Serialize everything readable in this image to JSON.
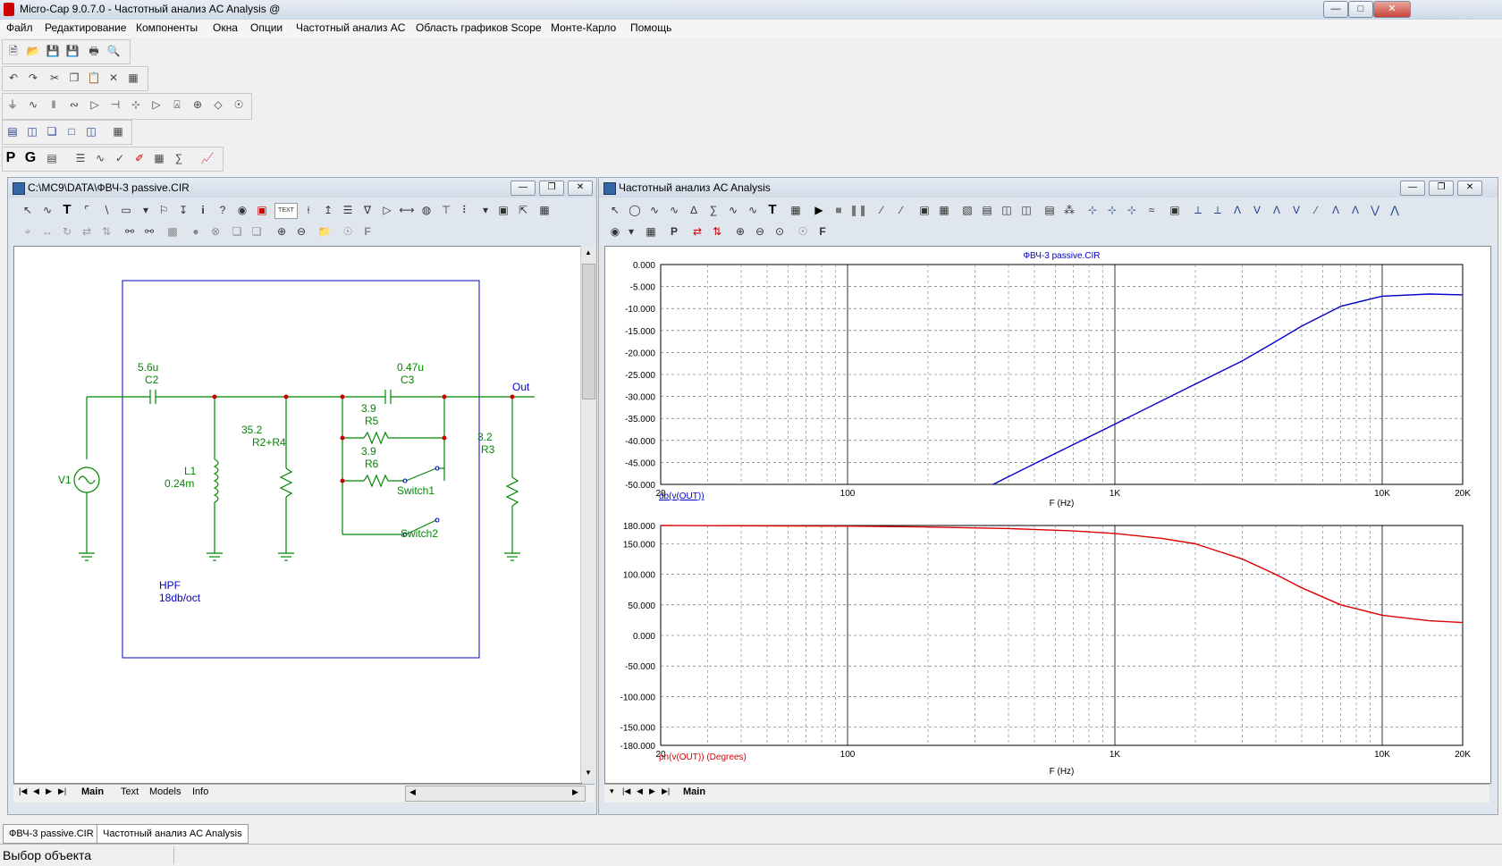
{
  "window": {
    "title": "Micro-Cap 9.0.7.0 - Частотный анализ AC Analysis @"
  },
  "menu": [
    "Файл",
    "Редактирование",
    "Компоненты",
    "Окна",
    "Опции",
    "Частотный анализ AC",
    "Область графиков Scope",
    "Монте-Карло",
    "Помощь"
  ],
  "schematic": {
    "title": "C:\\MC9\\DATA\\ФВЧ-3 passive.CIR",
    "labels": {
      "c2_value": "5.6u",
      "c2_name": "C2",
      "c3_value": "0.47u",
      "c3_name": "C3",
      "out": "Out",
      "l1_name": "L1",
      "l1_value": "0.24m",
      "r24_value": "35.2",
      "r24_name": "R2+R4",
      "r5_value": "3.9",
      "r5_name": "R5",
      "r6_value": "3.9",
      "r6_name": "R6",
      "switch1": "Switch1",
      "switch2": "Switch2",
      "r3_value": "3.2",
      "r3_name": "R3",
      "v1": "V1",
      "hpf": "HPF",
      "slope": "18db/oct"
    },
    "toolbar_text_button": "TEXT",
    "tabs": [
      "Main",
      "Text",
      "Models",
      "Info"
    ]
  },
  "analysis": {
    "title": "Частотный анализ AC Analysis",
    "tabs": [
      "Main"
    ]
  },
  "chart_data": [
    {
      "type": "line",
      "title": "ФВЧ-3 passive.CIR",
      "xlabel": "F (Hz)",
      "ylabel": "db(v(OUT))",
      "xscale": "log",
      "xlim": [
        20,
        20000
      ],
      "ylim": [
        -50,
        0
      ],
      "x_ticks": [
        "20",
        "100",
        "1K",
        "10K",
        "20K"
      ],
      "y_ticks": [
        "0.000",
        "-5.000",
        "-10.000",
        "-15.000",
        "-20.000",
        "-25.000",
        "-30.000",
        "-35.000",
        "-40.000",
        "-45.000",
        "-50.000"
      ],
      "grid": true,
      "color": "#0000cc",
      "series": [
        {
          "x": [
            350,
            500,
            1000,
            2000,
            3000,
            4000,
            5000,
            7000,
            10000,
            15000,
            20000
          ],
          "values": [
            -50,
            -45.3,
            -36.3,
            -27.2,
            -21.9,
            -17.5,
            -14.0,
            -9.5,
            -7.2,
            -6.7,
            -6.9
          ]
        }
      ]
    },
    {
      "type": "line",
      "xlabel": "F (Hz)",
      "ylabel": "ph(v(OUT)) (Degrees)",
      "xscale": "log",
      "xlim": [
        20,
        20000
      ],
      "ylim": [
        -180,
        180
      ],
      "x_ticks": [
        "20",
        "100",
        "1K",
        "10K",
        "20K"
      ],
      "y_ticks": [
        "180.000",
        "150.000",
        "100.000",
        "50.000",
        "0.000",
        "-50.000",
        "-100.000",
        "-150.000",
        "-180.000"
      ],
      "grid": true,
      "color": "#dd0000",
      "series": [
        {
          "x": [
            20,
            100,
            200,
            400,
            700,
            1000,
            1500,
            2000,
            3000,
            4000,
            5000,
            7000,
            10000,
            15000,
            20000
          ],
          "values": [
            180,
            179,
            177.5,
            175,
            171,
            167,
            159,
            150,
            125,
            100,
            78,
            50,
            33,
            24,
            21
          ]
        }
      ]
    }
  ],
  "status": {
    "text": "Выбор объекта"
  },
  "doc_tabs": [
    "ФВЧ-3 passive.CIR",
    "Частотный анализ AC Analysis"
  ]
}
